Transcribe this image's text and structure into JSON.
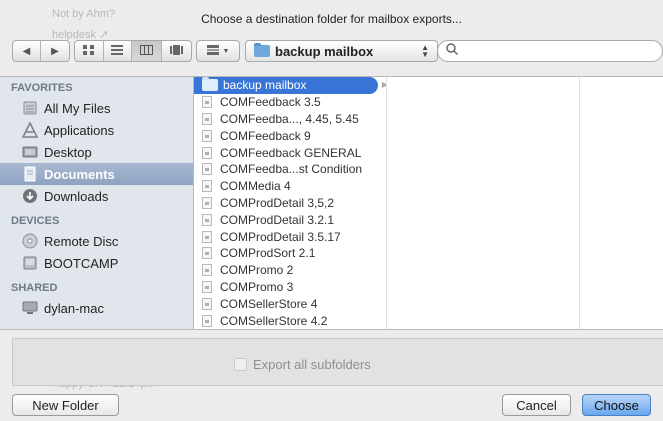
{
  "background": {
    "ghost_top_1": "Not by Ahm?",
    "ghost_top_2": "helpdesk ↗",
    "ghost_bottom_1": "helpdesk",
    "ghost_bottom_2": "Happy CNY 12:14pm"
  },
  "dialog": {
    "title": "Choose a destination folder for mailbox exports..."
  },
  "toolbar": {
    "current_folder": "backup mailbox",
    "search_value": "",
    "search_placeholder": ""
  },
  "sidebar": {
    "sections": [
      {
        "header": "FAVORITES",
        "items": [
          {
            "label": "All My Files",
            "icon": "all-files-icon"
          },
          {
            "label": "Applications",
            "icon": "applications-icon"
          },
          {
            "label": "Desktop",
            "icon": "desktop-icon"
          },
          {
            "label": "Documents",
            "icon": "documents-icon",
            "selected": true
          },
          {
            "label": "Downloads",
            "icon": "downloads-icon"
          }
        ]
      },
      {
        "header": "DEVICES",
        "items": [
          {
            "label": "Remote Disc",
            "icon": "disc-icon"
          },
          {
            "label": "BOOTCAMP",
            "icon": "drive-icon"
          }
        ]
      },
      {
        "header": "SHARED",
        "items": [
          {
            "label": "dylan-mac",
            "icon": "computer-icon"
          }
        ]
      }
    ]
  },
  "browser": {
    "column1": [
      {
        "name": "backup mailbox",
        "type": "folder",
        "selected": true
      },
      {
        "name": "COMFeedback 3.5",
        "type": "file"
      },
      {
        "name": "COMFeedba..., 4.45, 5.45",
        "type": "file"
      },
      {
        "name": "COMFeedback 9",
        "type": "file"
      },
      {
        "name": "COMFeedback GENERAL",
        "type": "file"
      },
      {
        "name": "COMFeedba...st Condition",
        "type": "file"
      },
      {
        "name": "COMMedia 4",
        "type": "file"
      },
      {
        "name": "COMProdDetail 3,5,2",
        "type": "file"
      },
      {
        "name": "COMProdDetail 3.2.1",
        "type": "file"
      },
      {
        "name": "COMProdDetail 3.5.17",
        "type": "file"
      },
      {
        "name": "COMProdSort 2.1",
        "type": "file"
      },
      {
        "name": "COMPromo 2",
        "type": "file"
      },
      {
        "name": "COMPromo 3",
        "type": "file"
      },
      {
        "name": "COMSellerStore 4",
        "type": "file"
      },
      {
        "name": "COMSellerStore 4.2",
        "type": "file"
      }
    ]
  },
  "options": {
    "export_subfolders_label": "Export all subfolders",
    "export_subfolders_checked": false
  },
  "buttons": {
    "new_folder": "New Folder",
    "cancel": "Cancel",
    "choose": "Choose"
  }
}
